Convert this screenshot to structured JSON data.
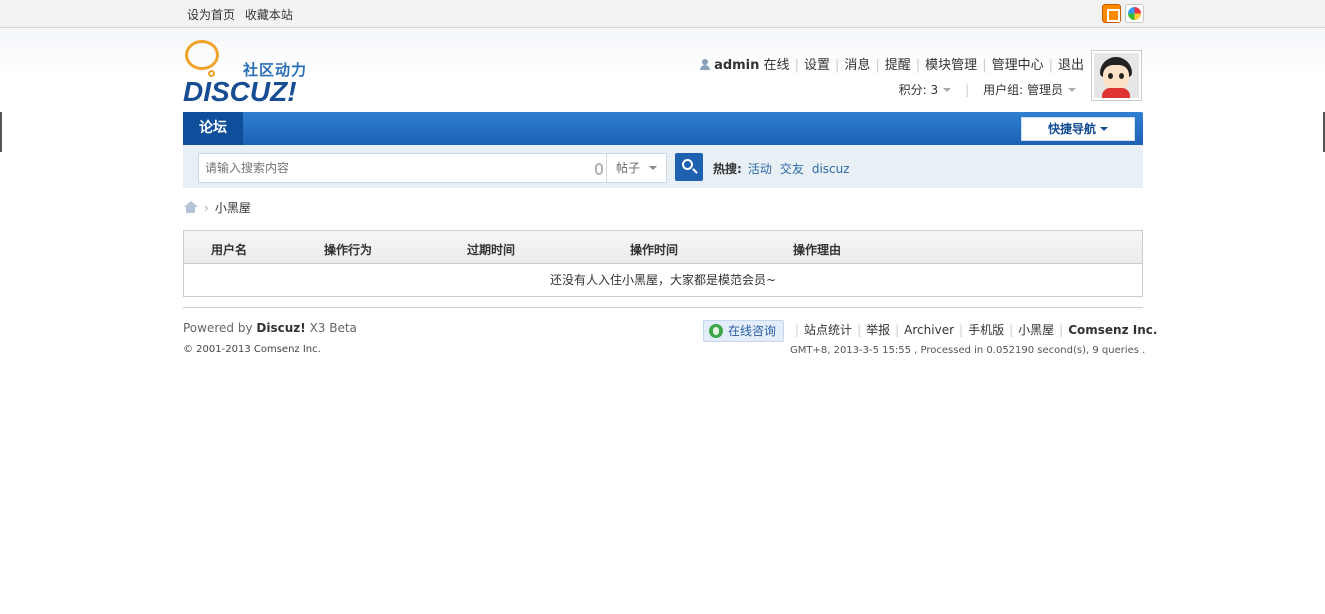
{
  "topbar": {
    "set_home": "设为首页",
    "bookmark": "收藏本站"
  },
  "logo": {
    "slogan": "社区动力",
    "word": "DISCUZ!"
  },
  "usernav": {
    "username": "admin",
    "online": "在线",
    "items": [
      "设置",
      "消息",
      "提醒",
      "模块管理",
      "管理中心",
      "退出"
    ]
  },
  "userinfo": {
    "credits": "积分: 3",
    "group": "用户组: 管理员"
  },
  "nav": {
    "forum_tab": "论坛",
    "quick_nav": "快捷导航"
  },
  "search": {
    "placeholder": "请输入搜索内容",
    "type": "帖子",
    "hot_label": "热搜:",
    "hot_items": [
      "活动",
      "交友",
      "discuz"
    ]
  },
  "breadcrumb": {
    "current": "小黑屋",
    "arrow": "›"
  },
  "table": {
    "columns": [
      "用户名",
      "操作行为",
      "过期时间",
      "操作时间",
      "操作理由"
    ],
    "empty_message": "还没有人入住小黑屋，大家都是模范会员~"
  },
  "footer": {
    "powered_prefix": "Powered by",
    "powered_brand": "Discuz!",
    "powered_version": "X3 Beta",
    "copyright": "© 2001-2013 Comsenz Inc.",
    "consult": "在线咨询",
    "links": [
      "站点统计",
      "举报",
      "Archiver",
      "手机版",
      "小黑屋"
    ],
    "company": "Comsenz Inc.",
    "processed": "GMT+8, 2013-3-5 15:55 , Processed in 0.052190 second(s), 9 queries ."
  },
  "colors": {
    "nav_blue": "#1d62b4",
    "tab_dark": "#0f4e9a",
    "link": "#2d6aa6",
    "logo_orange": "#f0a32a"
  }
}
